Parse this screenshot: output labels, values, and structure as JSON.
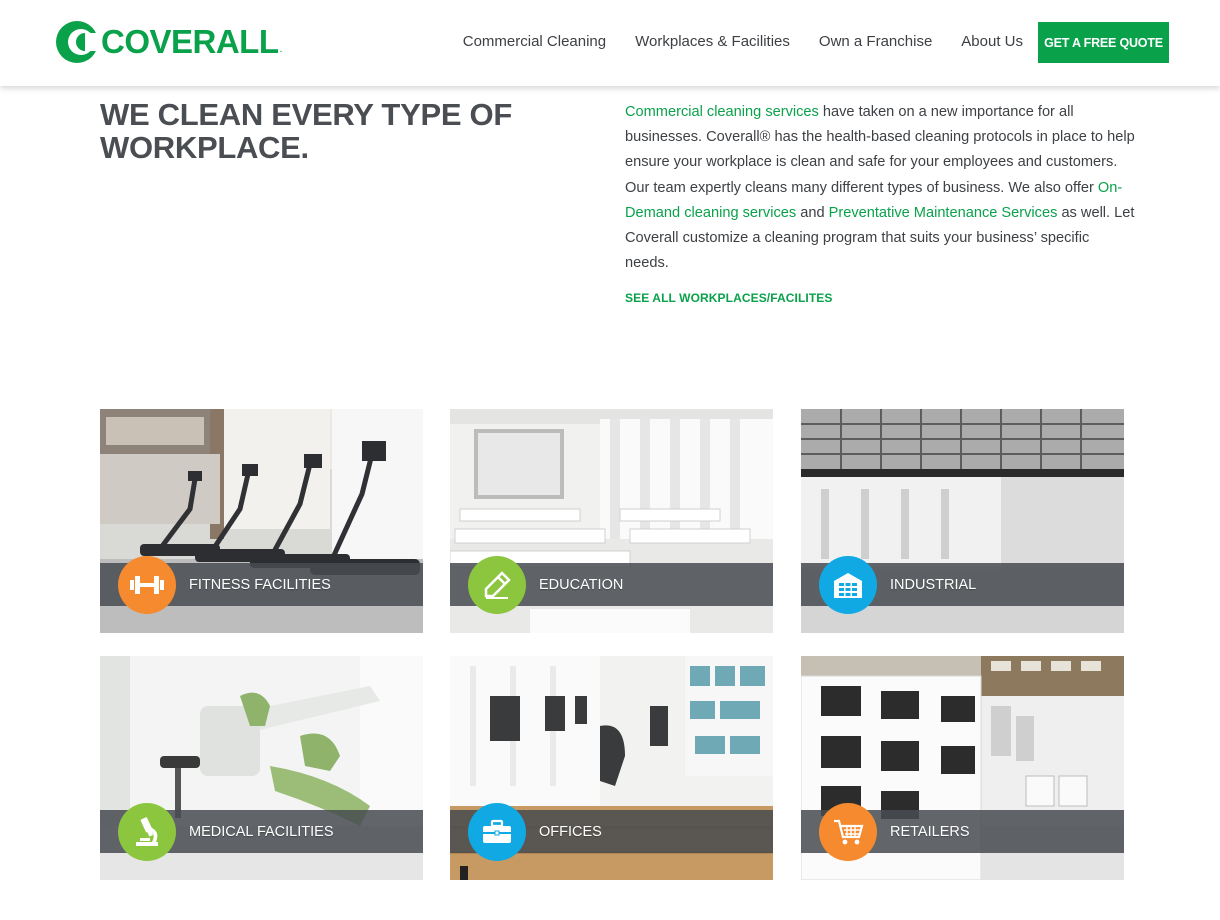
{
  "brand": {
    "name": "COVERALL",
    "mark": ".",
    "green": "#0aa14b"
  },
  "nav": {
    "items": [
      "Commercial Cleaning",
      "Workplaces & Facilities",
      "Own a Franchise",
      "About Us"
    ],
    "cta": "GET A FREE QUOTE"
  },
  "hero": {
    "title_line1": "WE CLEAN EVERY TYPE OF",
    "title_line2": "WORKPLACE."
  },
  "intro": {
    "link1": "Commercial cleaning services",
    "text1": " have taken on a new importance for all businesses. Coverall® has the health-based cleaning protocols in place to help ensure your workplace is clean and safe for your employees and customers. Our team expertly cleans many different types of business. We also offer ",
    "link2": "On-Demand cleaning services",
    "text2": " and ",
    "link3": "Preventative Maintenance Services",
    "text3": " as well. Let Coverall customize a cleaning program that suits your business’ specific needs.",
    "see_all": "SEE ALL WORKPLACES/FACILITES"
  },
  "cards": [
    {
      "label": "FITNESS FACILITIES",
      "icon": "dumbbell-icon",
      "color": "#f58a2e"
    },
    {
      "label": "EDUCATION",
      "icon": "pencil-icon",
      "color": "#8cc63f"
    },
    {
      "label": "INDUSTRIAL",
      "icon": "warehouse-icon",
      "color": "#11a9e3"
    },
    {
      "label": "MEDICAL FACILITIES",
      "icon": "microscope-icon",
      "color": "#8cc63f"
    },
    {
      "label": "OFFICES",
      "icon": "briefcase-icon",
      "color": "#11a9e3"
    },
    {
      "label": "RETAILERS",
      "icon": "cart-icon",
      "color": "#f58a2e"
    }
  ]
}
